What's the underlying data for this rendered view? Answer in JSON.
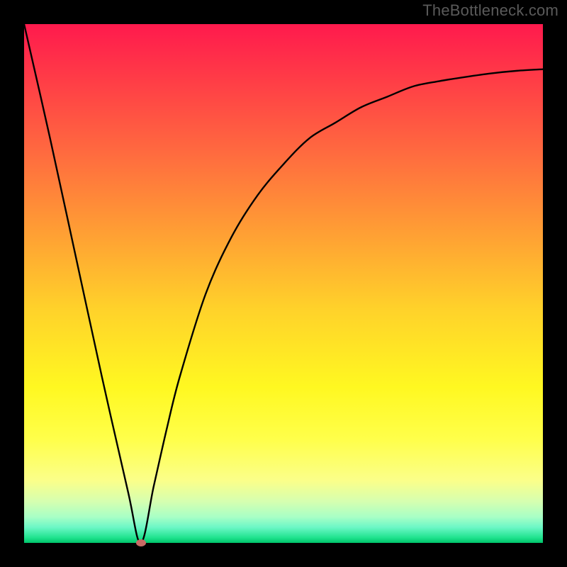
{
  "watermark": "TheBottleneck.com",
  "colors": {
    "frame": "#000000",
    "curve": "#000000",
    "marker": "#c96b65",
    "gradient_top": "#ff1a4d",
    "gradient_bottom": "#00c46a"
  },
  "chart_data": {
    "type": "line",
    "title": "",
    "xlabel": "",
    "ylabel": "",
    "xlim": [
      0,
      100
    ],
    "ylim": [
      0,
      100
    ],
    "axes_visible": false,
    "grid": false,
    "background": "vertical-gradient red→orange→yellow→green",
    "series": [
      {
        "name": "bottleneck-curve",
        "x": [
          0,
          5,
          10,
          15,
          20,
          22.5,
          25,
          27.5,
          30,
          35,
          40,
          45,
          50,
          55,
          60,
          65,
          70,
          75,
          80,
          85,
          90,
          95,
          100
        ],
        "y": [
          100,
          78,
          55,
          32,
          10,
          0,
          11,
          22,
          32,
          48,
          59,
          67,
          73,
          78,
          81,
          84,
          86,
          88,
          89,
          89.8,
          90.5,
          91,
          91.3
        ]
      }
    ],
    "marker": {
      "x": 22.5,
      "y": 0,
      "shape": "ellipse",
      "color": "#c96b65"
    }
  }
}
